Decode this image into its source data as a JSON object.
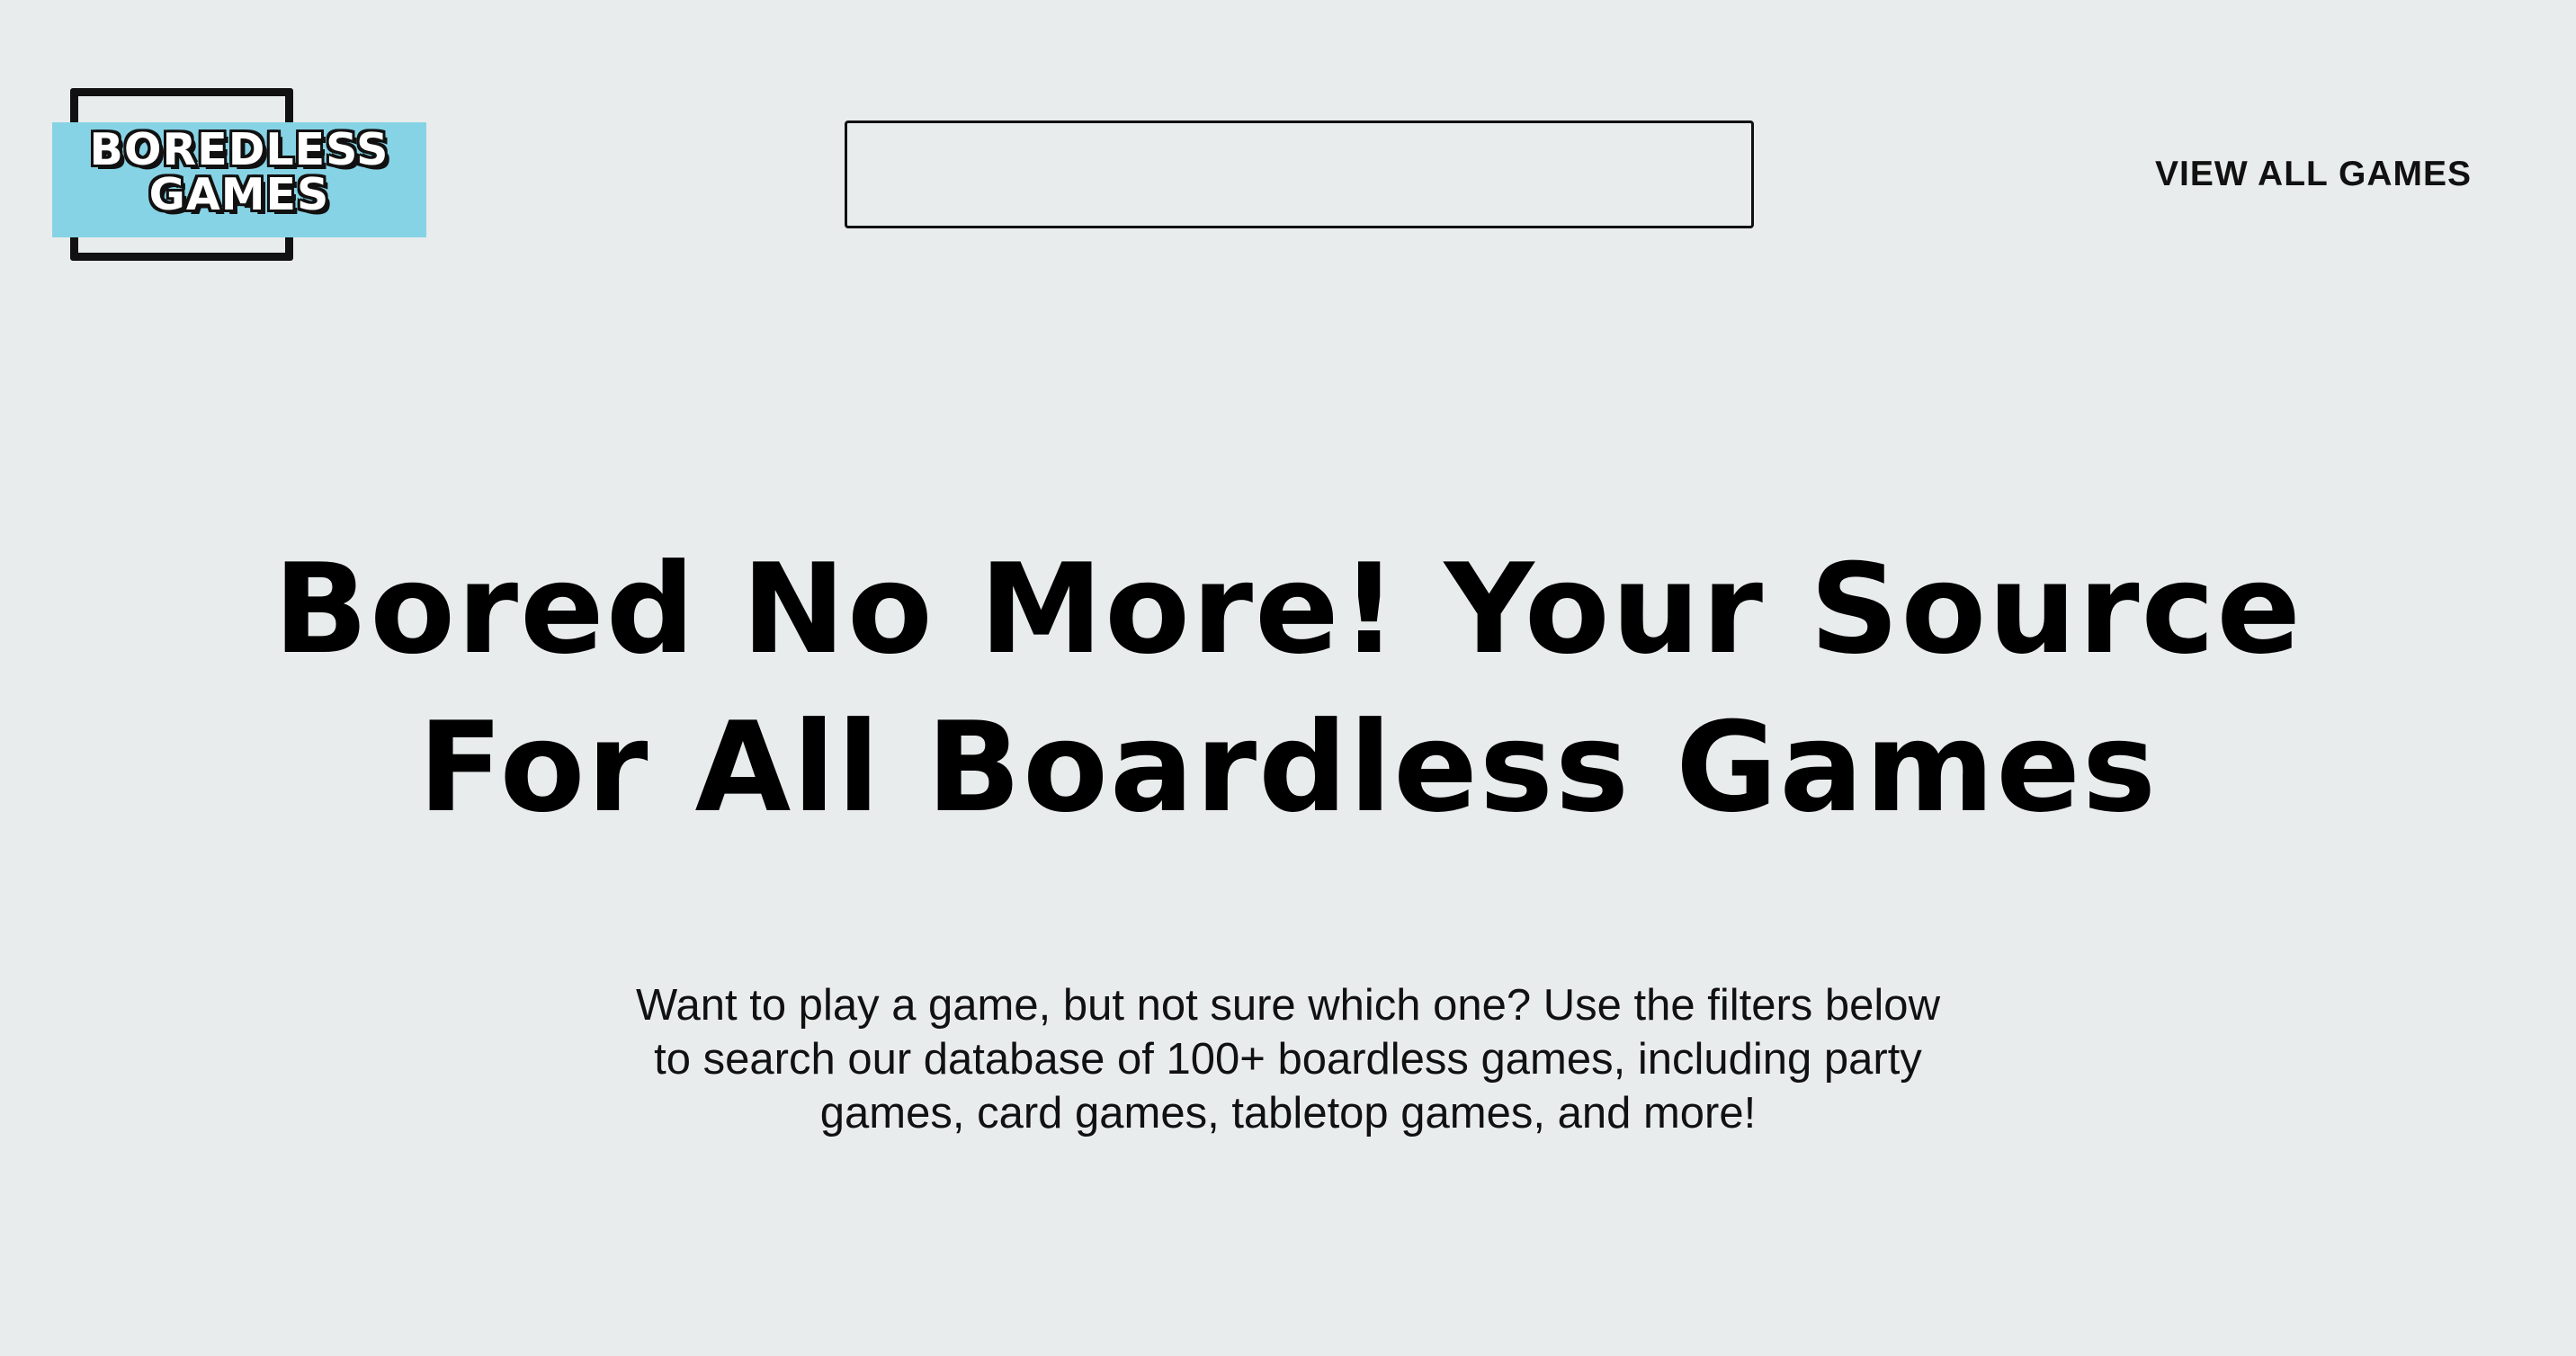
{
  "header": {
    "logo": {
      "line1": "BOREDLESS",
      "line2": "GAMES"
    },
    "search": {
      "value": "",
      "placeholder": ""
    },
    "nav": {
      "view_all_label": "VIEW ALL GAMES"
    }
  },
  "hero": {
    "title_line1": "Bored No More! Your Source",
    "title_line2": "For All Boardless Games",
    "subtitle_line1": "Want to play a game, but not sure which one? Use the filters below",
    "subtitle_line2": "to search our database of 100+ boardless games, including party",
    "subtitle_line3": "games, card games, tabletop games, and more!"
  },
  "colors": {
    "background": "#e8ecec",
    "logo_band": "#87d3e6",
    "text": "#000000"
  }
}
